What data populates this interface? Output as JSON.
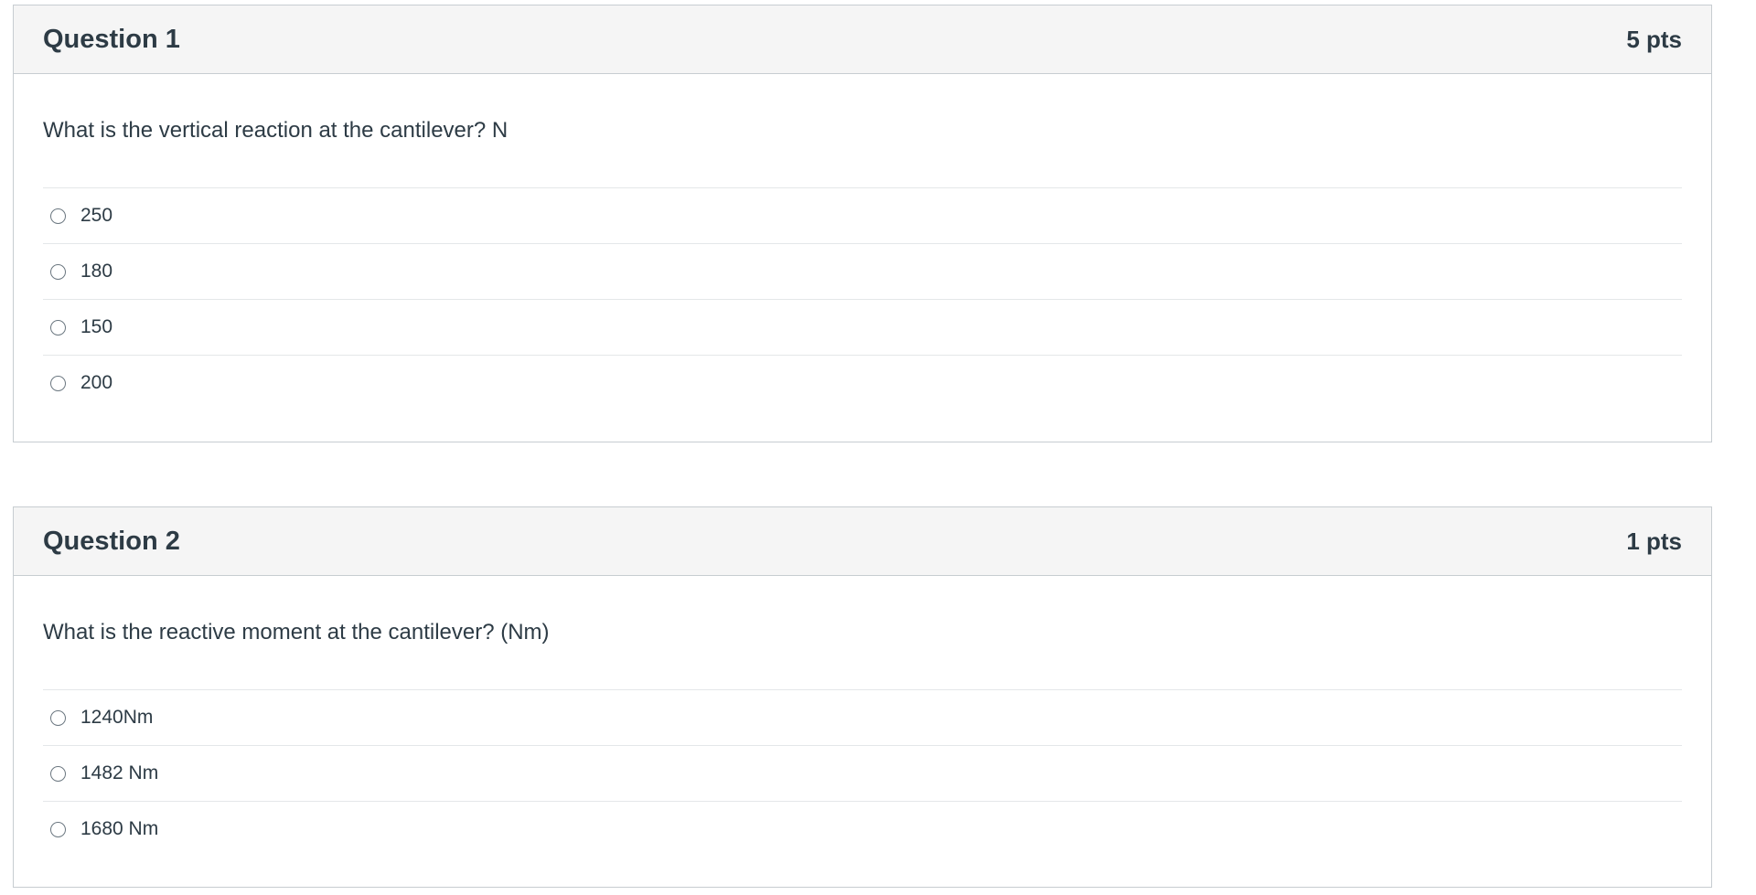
{
  "questions": [
    {
      "title": "Question 1",
      "points": "5 pts",
      "text": "What is the vertical reaction at the cantilever? N",
      "answers": [
        "250",
        "180",
        "150",
        "200"
      ]
    },
    {
      "title": "Question 2",
      "points": "1 pts",
      "text": "What is the reactive moment at the cantilever? (Nm)",
      "answers": [
        "1240Nm",
        "1482 Nm",
        "1680 Nm"
      ]
    }
  ]
}
